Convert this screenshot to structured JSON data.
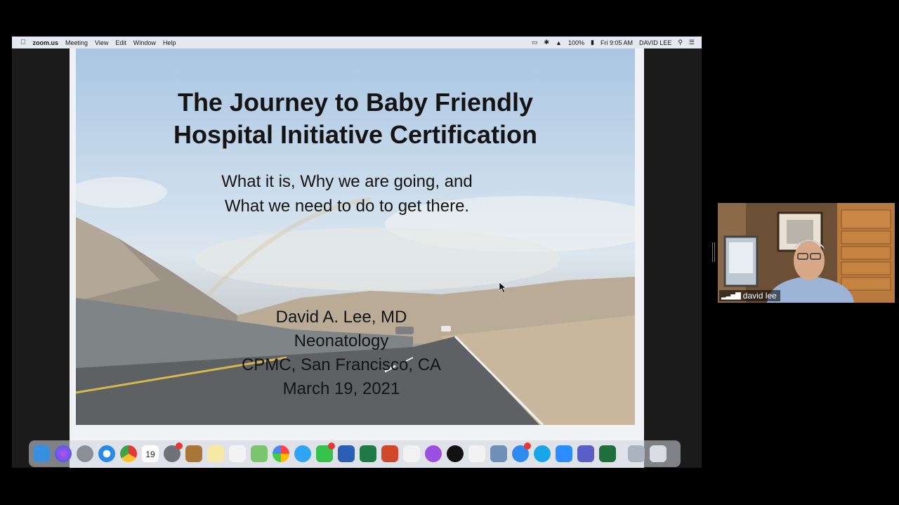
{
  "menubar": {
    "app": "zoom.us",
    "items": [
      "Meeting",
      "View",
      "Edit",
      "Window",
      "Help"
    ],
    "battery": "100%",
    "clock": "Fri 9:05 AM",
    "user": "DAVID LEE"
  },
  "slide": {
    "title_line1": "The Journey to Baby Friendly",
    "title_line2": "Hospital Initiative Certification",
    "subtitle_line1": "What it is, Why we are going, and",
    "subtitle_line2": "What we need to do to get there.",
    "author": "David A. Lee, MD",
    "department": "Neonatology",
    "institution": "CPMC, San Francisco, CA",
    "date": "March 19, 2021"
  },
  "dock": {
    "calendar_day": "19",
    "apps": [
      "finder",
      "siri",
      "launchpad",
      "safari",
      "chrome",
      "calendar",
      "system-preferences",
      "notes",
      "stickies",
      "reminders",
      "maps",
      "photos",
      "messages",
      "facetime",
      "word",
      "excel",
      "powerpoint",
      "music",
      "podcasts",
      "tv",
      "news",
      "preview",
      "app-store",
      "skype",
      "zoom",
      "teams",
      "excel-2",
      "finder-window",
      "trash"
    ]
  },
  "video": {
    "participant_name": "david lee"
  },
  "colors": {
    "menubar_bg": "#e3e9ef",
    "window_bg": "#1b1b1b",
    "name_label_bg": "#000000"
  }
}
